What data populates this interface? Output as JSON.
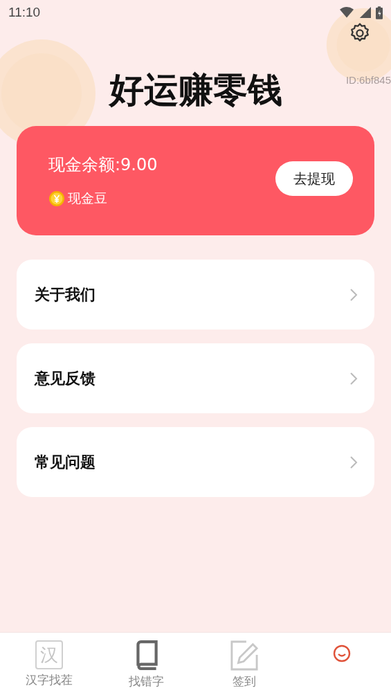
{
  "status_bar": {
    "time": "11:10"
  },
  "header": {
    "title": "好运赚零钱",
    "user_id": "ID:6bf845"
  },
  "balance_card": {
    "balance": "现金余额:9.00",
    "coin_label": "现金豆",
    "withdraw_button": "去提现"
  },
  "menu": [
    {
      "label": "关于我们"
    },
    {
      "label": "意见反馈"
    },
    {
      "label": "常见问题"
    }
  ],
  "tabs": [
    {
      "kind": "hanzi",
      "icon_text": "汉",
      "label": "汉字找茬",
      "selected": false
    },
    {
      "kind": "book",
      "label": "找错字",
      "selected": false
    },
    {
      "kind": "edit",
      "label": "签到",
      "selected": false
    },
    {
      "kind": "face",
      "selected": true
    }
  ]
}
